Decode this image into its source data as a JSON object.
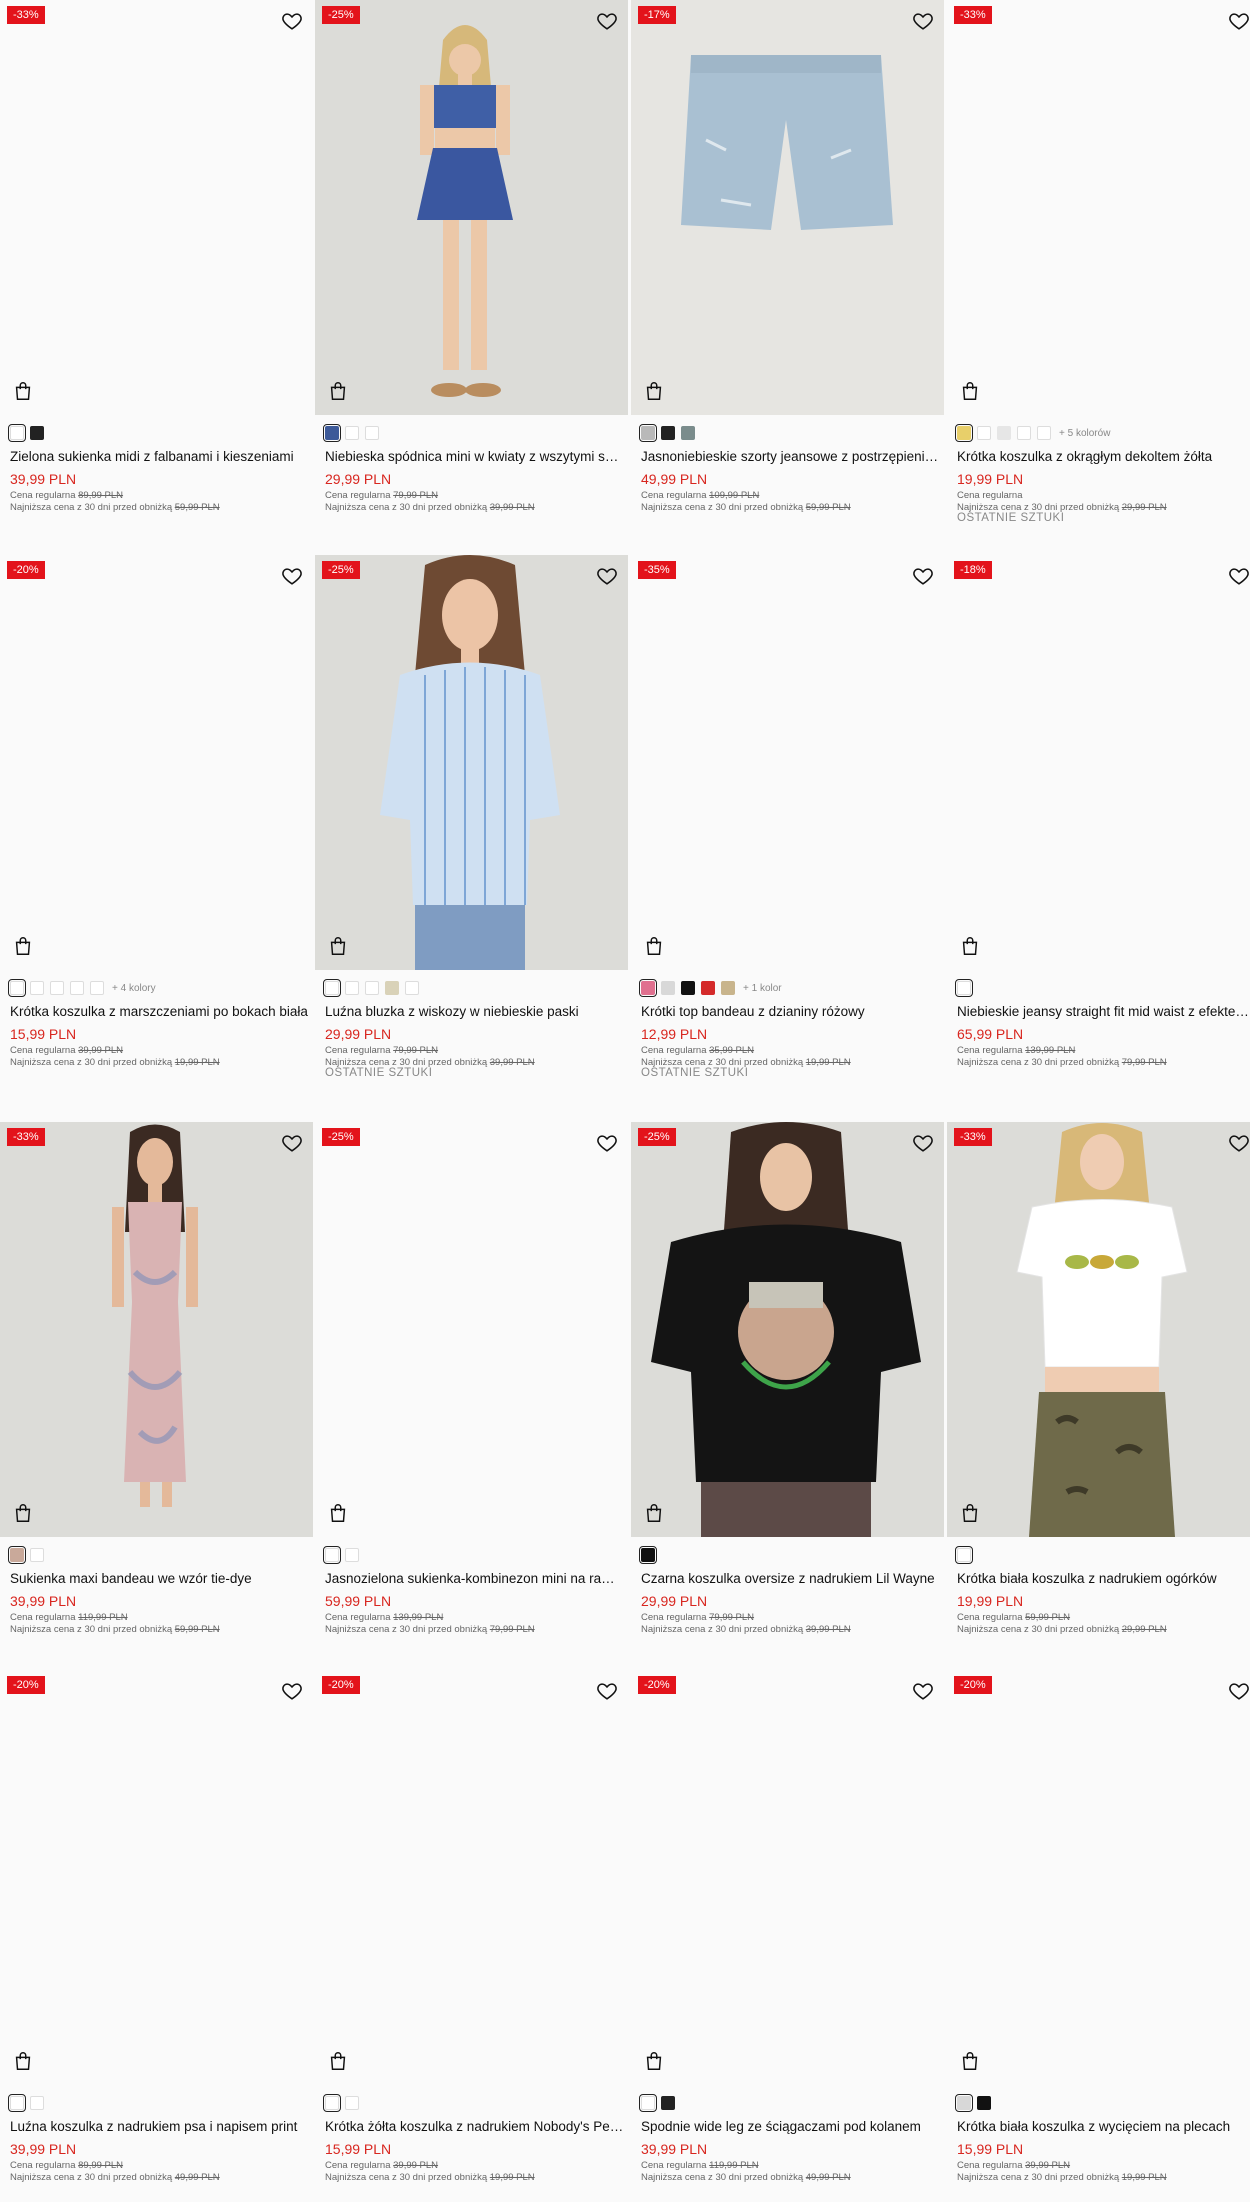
{
  "labels": {
    "regular_prefix": "Cena regularna",
    "lowest_prefix": "Najniższa cena z 30 dni przed obniżką"
  },
  "products": [
    {
      "badge": "-33%",
      "photo": "none",
      "swatches": [
        {
          "c": "#ffffff",
          "sel": true
        },
        {
          "c": "#222222"
        }
      ],
      "more": "",
      "title": "Zielona sukienka midi z falbanami i kieszeniami",
      "price": "39,99 PLN",
      "regular": "89,99 PLN",
      "lowest": "59,99 PLN",
      "last": ""
    },
    {
      "badge": "-25%",
      "photo": "model-blue-set",
      "swatches": [
        {
          "c": "#3d5a99",
          "sel": true
        },
        {
          "c": "#ffffff"
        },
        {
          "c": "#ffffff"
        }
      ],
      "more": "",
      "title": "Niebieska spódnica mini w kwiaty z wszytymi szortami",
      "price": "29,99 PLN",
      "regular": "79,99 PLN",
      "lowest": "39,99 PLN",
      "last": ""
    },
    {
      "badge": "-17%",
      "photo": "denim-shorts",
      "swatches": [
        {
          "c": "#b9b9b9",
          "sel": true
        },
        {
          "c": "#222222"
        },
        {
          "c": "#7a8c8c"
        }
      ],
      "more": "",
      "title": "Jasnoniebieskie szorty jeansowe z postrzępieniami",
      "price": "49,99 PLN",
      "regular": "109,99 PLN",
      "lowest": "59,99 PLN",
      "last": ""
    },
    {
      "badge": "-33%",
      "photo": "none",
      "swatches": [
        {
          "c": "#e8cf6a",
          "sel": true
        },
        {
          "c": "#ffffff"
        },
        {
          "c": "#e6e6e6"
        },
        {
          "c": "#ffffff"
        },
        {
          "c": "#ffffff"
        }
      ],
      "more": "+ 5 kolorów",
      "title": "Krótka koszulka z okrągłym dekoltem żółta",
      "price": "19,99 PLN",
      "regular": "",
      "lowest": "29,99 PLN",
      "last": "OSTATNIE SZTUKI"
    },
    {
      "badge": "-20%",
      "photo": "none",
      "swatches": [
        {
          "c": "#ffffff",
          "sel": true
        },
        {
          "c": "#ffffff"
        },
        {
          "c": "#ffffff"
        },
        {
          "c": "#ffffff"
        },
        {
          "c": "#ffffff"
        }
      ],
      "more": "+ 4 kolory",
      "title": "Krótka koszulka z marszczeniami po bokach biała",
      "price": "15,99 PLN",
      "regular": "39,99 PLN",
      "lowest": "19,99 PLN",
      "last": ""
    },
    {
      "badge": "-25%",
      "photo": "model-striped-blouse",
      "swatches": [
        {
          "c": "#ffffff",
          "sel": true
        },
        {
          "c": "#ffffff"
        },
        {
          "c": "#ffffff"
        },
        {
          "c": "#d9d2b8"
        },
        {
          "c": "#ffffff"
        }
      ],
      "more": "",
      "title": "Luźna bluzka z wiskozy w niebieskie paski",
      "price": "29,99 PLN",
      "regular": "79,99 PLN",
      "lowest": "39,99 PLN",
      "last": "OSTATNIE SZTUKI"
    },
    {
      "badge": "-35%",
      "photo": "none",
      "swatches": [
        {
          "c": "#e0708f",
          "sel": true
        },
        {
          "c": "#d8d8d8"
        },
        {
          "c": "#111111"
        },
        {
          "c": "#d42a2a"
        },
        {
          "c": "#c8b48c"
        }
      ],
      "more": "+ 1 kolor",
      "title": "Krótki top bandeau z dzianiny różowy",
      "price": "12,99 PLN",
      "regular": "35,99 PLN",
      "lowest": "19,99 PLN",
      "last": "OSTATNIE SZTUKI"
    },
    {
      "badge": "-18%",
      "photo": "none",
      "swatches": [
        {
          "c": "#ffffff",
          "sel": true
        }
      ],
      "more": "",
      "title": "Niebieskie jeansy straight fit mid waist z efektem sprania",
      "price": "65,99 PLN",
      "regular": "139,99 PLN",
      "lowest": "79,99 PLN",
      "last": ""
    },
    {
      "badge": "-33%",
      "photo": "model-tiedye-dress",
      "swatches": [
        {
          "c": "#c9a99a",
          "sel": true
        },
        {
          "c": "#ffffff"
        }
      ],
      "more": "",
      "title": "Sukienka maxi bandeau we wzór tie-dye",
      "price": "39,99 PLN",
      "regular": "119,99 PLN",
      "lowest": "59,99 PLN",
      "last": ""
    },
    {
      "badge": "-25%",
      "photo": "none",
      "swatches": [
        {
          "c": "#ffffff",
          "sel": true
        },
        {
          "c": "#ffffff"
        }
      ],
      "more": "",
      "title": "Jasnozielona sukienka-kombinezon mini na ramiączkach",
      "price": "59,99 PLN",
      "regular": "139,99 PLN",
      "lowest": "79,99 PLN",
      "last": ""
    },
    {
      "badge": "-25%",
      "photo": "model-black-tee",
      "swatches": [
        {
          "c": "#111111",
          "sel": true
        }
      ],
      "more": "",
      "title": "Czarna koszulka oversize z nadrukiem Lil Wayne",
      "price": "29,99 PLN",
      "regular": "79,99 PLN",
      "lowest": "39,99 PLN",
      "last": ""
    },
    {
      "badge": "-33%",
      "photo": "model-white-tee",
      "swatches": [
        {
          "c": "#ffffff",
          "sel": true
        }
      ],
      "more": "",
      "title": "Krótka biała koszulka z nadrukiem ogórków",
      "price": "19,99 PLN",
      "regular": "59,99 PLN",
      "lowest": "29,99 PLN",
      "last": ""
    },
    {
      "badge": "-20%",
      "photo": "none",
      "swatches": [
        {
          "c": "#ffffff",
          "sel": true
        },
        {
          "c": "#ffffff"
        }
      ],
      "more": "",
      "title": "Luźna koszulka z nadrukiem psa i napisem print",
      "price": "39,99 PLN",
      "regular": "89,99 PLN",
      "lowest": "49,99 PLN",
      "last": ""
    },
    {
      "badge": "-20%",
      "photo": "none",
      "swatches": [
        {
          "c": "#ffffff",
          "sel": true
        },
        {
          "c": "#ffffff"
        }
      ],
      "more": "",
      "title": "Krótka żółta koszulka z nadrukiem Nobody's Perfect",
      "price": "15,99 PLN",
      "regular": "39,99 PLN",
      "lowest": "19,99 PLN",
      "last": ""
    },
    {
      "badge": "-20%",
      "photo": "none",
      "swatches": [
        {
          "c": "#ffffff",
          "sel": true
        },
        {
          "c": "#222222"
        }
      ],
      "more": "",
      "title": "Spodnie wide leg ze ściągaczami pod kolanem",
      "price": "39,99 PLN",
      "regular": "119,99 PLN",
      "lowest": "49,99 PLN",
      "last": ""
    },
    {
      "badge": "-20%",
      "photo": "none",
      "swatches": [
        {
          "c": "#d8d8d8",
          "sel": true
        },
        {
          "c": "#111111"
        }
      ],
      "more": "",
      "title": "Krótka biała koszulka z wycięciem na plecach",
      "price": "15,99 PLN",
      "regular": "39,99 PLN",
      "lowest": "19,99 PLN",
      "last": ""
    }
  ]
}
